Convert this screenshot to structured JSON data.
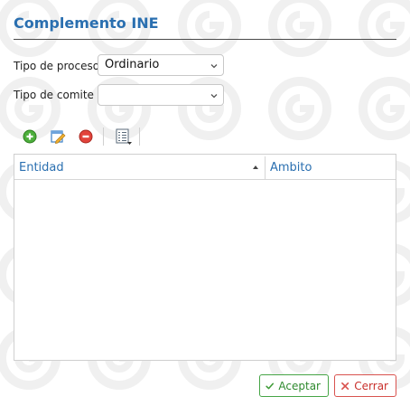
{
  "dialog": {
    "title": "Complemento INE"
  },
  "form": {
    "tipo_proceso": {
      "label": "Tipo de proceso",
      "value": "Ordinario"
    },
    "tipo_comite": {
      "label": "Tipo de comite",
      "value": ""
    }
  },
  "toolbar": {
    "items": [
      "add-icon",
      "edit-icon",
      "delete-icon",
      "columns-menu-icon"
    ]
  },
  "grid": {
    "columns": [
      {
        "label": "Entidad",
        "sort": "ascending"
      },
      {
        "label": "Ambito"
      }
    ],
    "rows": []
  },
  "footer": {
    "accept_label": "Aceptar",
    "close_label": "Cerrar"
  },
  "colors": {
    "title": "#2a6fb0",
    "accept": "#46a546",
    "close": "#d9534f"
  }
}
